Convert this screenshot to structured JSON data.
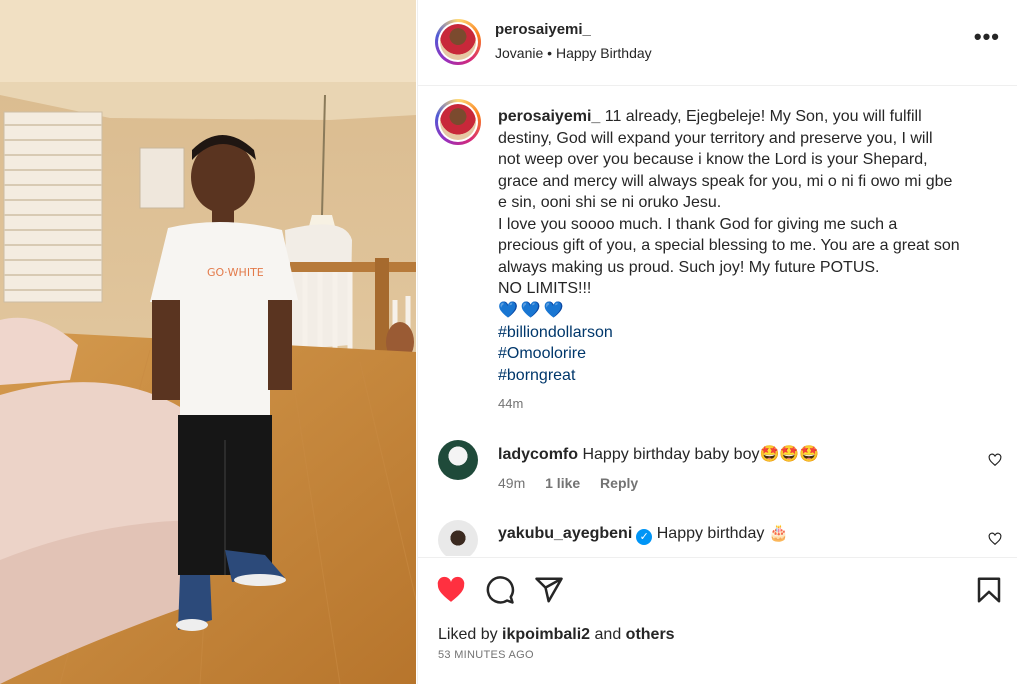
{
  "post": {
    "username": "perosaiyemi_",
    "subtitle_user": "Jovanie",
    "subtitle_sep": "•",
    "subtitle_audio": "Happy Birthday",
    "more_label": "•••"
  },
  "caption": {
    "username": "perosaiyemi_",
    "lines": [
      " 11 already, Ejegbeleje! My Son, you will fulfill",
      "destiny, God will expand your territory and preserve you, I will",
      "not weep over you because i know the Lord is your Shepard,",
      "grace and mercy will always speak for you, mi o ni fi owo mi gbe",
      "e sin, ooni shi se ni oruko Jesu.",
      "I love you soooo much. I thank God for giving me such a",
      "precious gift of you, a special blessing to me. You are a great son",
      "always making us proud. Such joy! My future POTUS.",
      "NO LIMITS!!!"
    ],
    "hearts": "💙💙💙",
    "hashtags": [
      "#billiondollarson",
      "#Omoolorire",
      "#borngreat"
    ],
    "time": "44m"
  },
  "comments": [
    {
      "username": "ladycomfo",
      "text": "Happy birthday baby boy",
      "emoji": "🤩🤩🤩",
      "time": "49m",
      "likes": "1 like",
      "reply": "Reply"
    },
    {
      "username": "yakubu_ayegbeni",
      "verified_mark": "✓",
      "text": "Happy birthday",
      "emoji": "🎂"
    }
  ],
  "footer": {
    "liked_prefix": "Liked by ",
    "liked_user": "ikpoimbali2",
    "liked_and": " and ",
    "liked_others": "others",
    "timestamp": "53 MINUTES AGO"
  },
  "colors": {
    "like_red": "#ff3040",
    "link_blue": "#00376b",
    "heart_blue": "#1e7be0",
    "verified_blue": "#0095f6"
  },
  "icons": [
    "more-icon",
    "heart-filled-icon",
    "comment-icon",
    "share-icon",
    "bookmark-icon",
    "comment-heart-icon"
  ]
}
